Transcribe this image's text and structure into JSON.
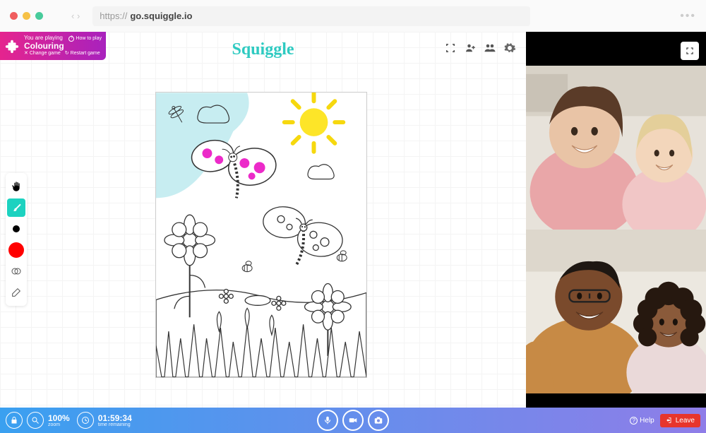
{
  "browser": {
    "protocol": "https://",
    "url": "go.squiggle.io"
  },
  "brand": {
    "logo_text": "Squiggle",
    "brand_color": "#2ecac1"
  },
  "game_badge": {
    "pretitle": "You are playing",
    "title": "Colouring",
    "how_to_play": "How to play",
    "change_game": "Change game",
    "restart_game": "Restart game"
  },
  "toolbar": {
    "tools": [
      {
        "name": "hand-tool",
        "icon": "hand",
        "active": false
      },
      {
        "name": "brush-tool",
        "icon": "brush",
        "active": true
      },
      {
        "name": "color-small",
        "icon": "color-dot",
        "value": "#000000"
      },
      {
        "name": "color-large",
        "icon": "color-fill",
        "value": "#ff0000"
      },
      {
        "name": "opacity-tool",
        "icon": "overlap"
      },
      {
        "name": "eraser-tool",
        "icon": "eraser"
      }
    ]
  },
  "top_icons": {
    "minimize": "minimize",
    "add_user": "add-user",
    "group": "group",
    "settings": "settings"
  },
  "video_panel": {
    "fullscreen_label": "fullscreen",
    "tiles": [
      {
        "name": "video-tile-1"
      },
      {
        "name": "video-tile-2"
      }
    ]
  },
  "bottom_bar": {
    "lock": "lock",
    "zoom": {
      "value": "100%",
      "label": "zoom"
    },
    "timer": {
      "value": "01:59:34",
      "label": "time remaining"
    },
    "mic": "mic",
    "camera": "camera",
    "snapshot": "snapshot",
    "help": "Help",
    "leave": "Leave"
  }
}
